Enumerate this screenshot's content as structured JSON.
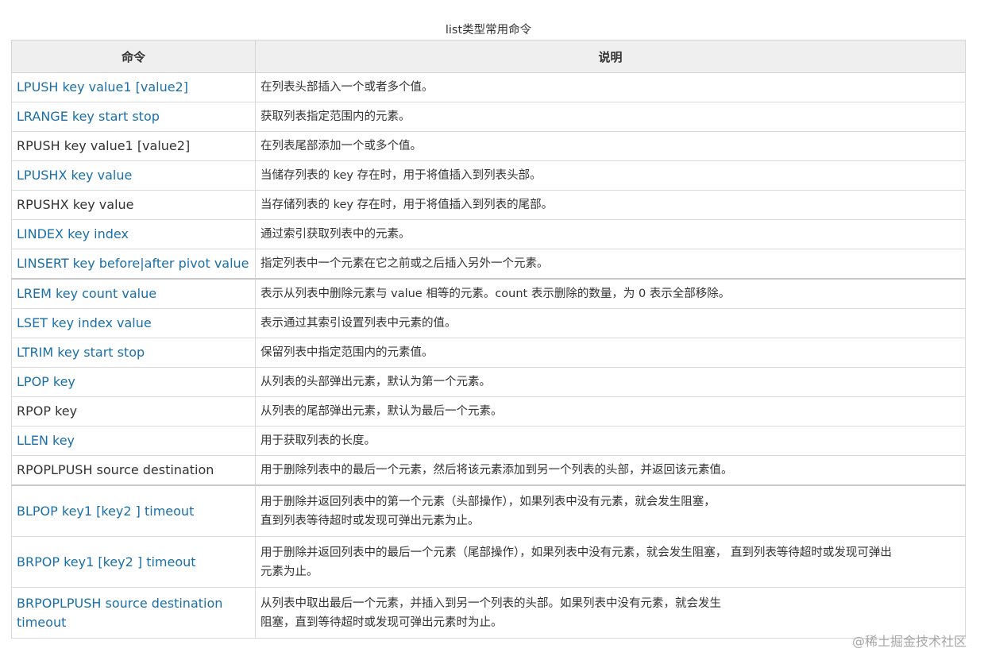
{
  "caption": "list类型常用命令",
  "header": {
    "command": "命令",
    "description": "说明"
  },
  "rows": [
    {
      "command": "LPUSH key value1 [value2]",
      "desc1": "在列表头部插入一个或者多个值。",
      "desc2": ""
    },
    {
      "command": "LRANGE key start stop",
      "desc1": "获取列表指定范围内的元素。",
      "desc2": ""
    },
    {
      "command": "RPUSH key value1 [value2]",
      "desc1": "在列表尾部添加一个或多个值。",
      "desc2": ""
    },
    {
      "command": "LPUSHX key value",
      "desc1": "当储存列表的 key 存在时，用于将值插入到列表头部。",
      "desc2": ""
    },
    {
      "command": "RPUSHX key value",
      "desc1": "当存储列表的 key 存在时，用于将值插入到列表的尾部。",
      "desc2": ""
    },
    {
      "command": "LINDEX key index",
      "desc1": "通过索引获取列表中的元素。",
      "desc2": ""
    },
    {
      "command": "LINSERT key before|after pivot value",
      "desc1": "指定列表中一个元素在它之前或之后插入另外一个元素。",
      "desc2": ""
    },
    {
      "command": "LREM key count value",
      "desc1": "表示从列表中删除元素与 value 相等的元素。count 表示删除的数量，为 0 表示全部移除。",
      "desc2": ""
    },
    {
      "command": "LSET key index value",
      "desc1": "表示通过其索引设置列表中元素的值。",
      "desc2": ""
    },
    {
      "command": "LTRIM key start stop",
      "desc1": "保留列表中指定范围内的元素值。",
      "desc2": ""
    },
    {
      "command": "LPOP key",
      "desc1": "从列表的头部弹出元素，默认为第一个元素。",
      "desc2": ""
    },
    {
      "command": "RPOP key",
      "desc1": "从列表的尾部弹出元素，默认为最后一个元素。",
      "desc2": ""
    },
    {
      "command": "LLEN key",
      "desc1": "用于获取列表的长度。",
      "desc2": ""
    },
    {
      "command": "RPOPLPUSH source destination",
      "desc1": "用于删除列表中的最后一个元素，然后将该元素添加到另一个列表的头部，并返回该元素值。",
      "desc2": ""
    },
    {
      "command": "BLPOP key1 [key2 ] timeout",
      "desc1": "用于删除并返回列表中的第一个元素（头部操作），如果列表中没有元素，就会发生阻塞，",
      "desc2": "直到列表等待超时或发现可弹出元素为止。"
    },
    {
      "command": "BRPOP key1 [key2 ] timeout",
      "desc1": "用于删除并返回列表中的最后一个元素（尾部操作），如果列表中没有元素，就会发生阻塞， 直到列表等待超时或发现可弹出",
      "desc2": "元素为止。"
    },
    {
      "command1": "BRPOPLPUSH source destination",
      "command2": "timeout",
      "desc1": "从列表中取出最后一个元素，并插入到另一个列表的头部。如果列表中没有元素，就会发生",
      "desc2": "阻塞，直到等待超时或发现可弹出元素时为止。"
    }
  ],
  "watermark": "@稀土掘金技术社区",
  "colors": {
    "link": "#1a6fa8",
    "plain": "#333333",
    "header_bg": "#efefef",
    "border": "#d9d9d9"
  }
}
